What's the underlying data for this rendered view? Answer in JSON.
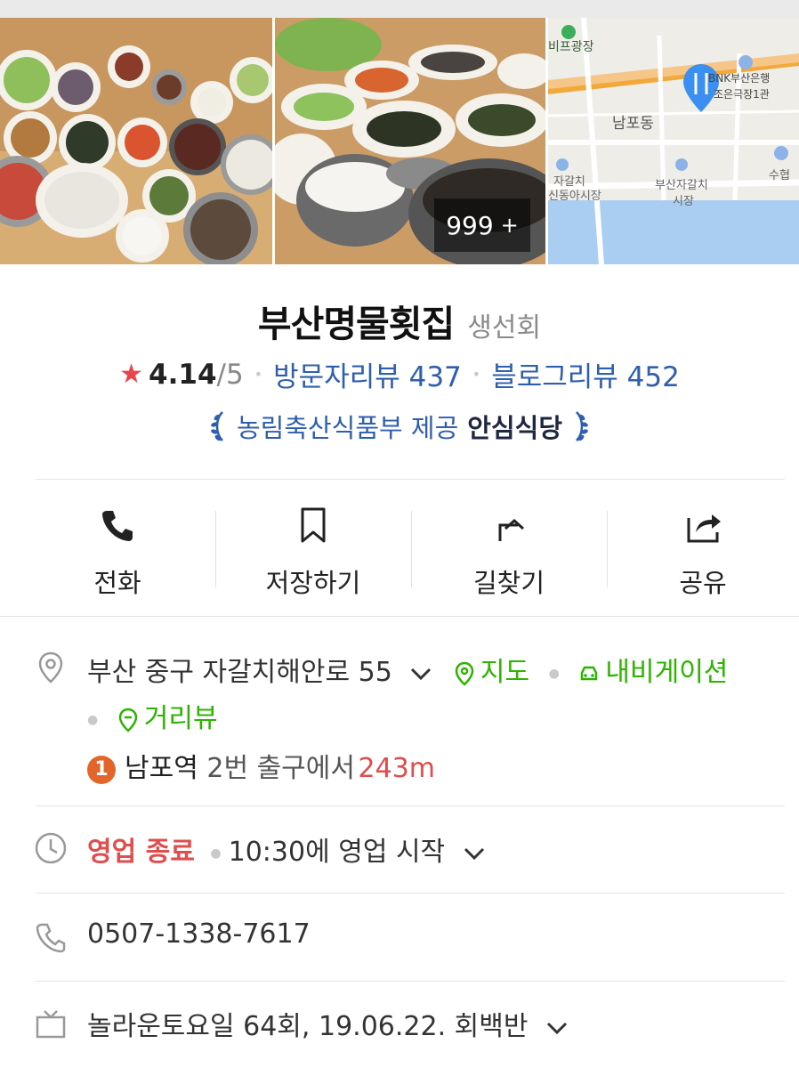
{
  "photos": {
    "count_value": "999",
    "count_plus": "+"
  },
  "map_preview": {
    "labels": {
      "plaza": "비프광장",
      "bank_line1": "BNK부산은행",
      "bank_line2": "조은극장1관",
      "district": "남포동",
      "market1_line1": "자갈치",
      "market1_line2": "신동아시장",
      "market2_line1": "부산자갈치",
      "market2_line2": "시장",
      "bank2": "수협"
    }
  },
  "place": {
    "name": "부산명물횟집",
    "category": "생선회",
    "rating_value": "4.14",
    "rating_max": "/5",
    "visitor_reviews_label": "방문자리뷰 437",
    "blog_reviews_label": "블로그리뷰 452",
    "badge_provider": "농림축산식품부 제공",
    "badge_name": "안심식당"
  },
  "actions": [
    {
      "label": "전화",
      "icon": "phone-icon"
    },
    {
      "label": "저장하기",
      "icon": "bookmark-icon"
    },
    {
      "label": "길찾기",
      "icon": "directions-icon"
    },
    {
      "label": "공유",
      "icon": "share-icon"
    }
  ],
  "address": {
    "text": "부산 중구 자갈치해안로 55",
    "map_label": "지도",
    "navigation_label": "내비게이션",
    "street_view_label": "거리뷰"
  },
  "transit": {
    "line_number": "1",
    "station": "남포역",
    "exit_text": "2번 출구에서",
    "distance": "243m"
  },
  "hours": {
    "status": "영업 종료",
    "next_open": "10:30에 영업 시작"
  },
  "phone": {
    "number": "0507-1338-7617"
  },
  "tv": {
    "text": "놀라운토요일 64회, 19.06.22. 회백반"
  },
  "colors": {
    "link_blue": "#2e5eae",
    "green": "#2db400",
    "closed_red": "#e04d4d",
    "star_red": "#e8464b",
    "subway_line1": "#e2662a",
    "map_pin_blue": "#3b8ff0"
  }
}
